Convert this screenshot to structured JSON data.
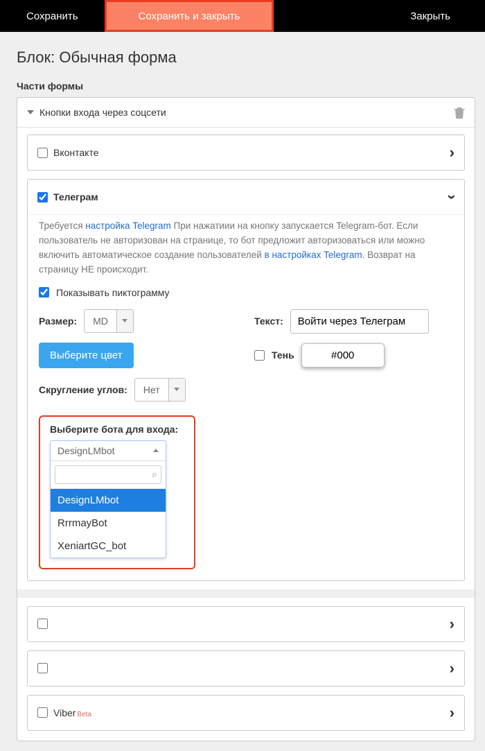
{
  "topbar": {
    "save": "Сохранить",
    "save_close": "Сохранить и закрыть",
    "close": "Закрыть"
  },
  "page": {
    "title": "Блок: Обычная форма",
    "parts_title": "Части формы"
  },
  "accordion": {
    "title": "Кнопки входа через соцсети"
  },
  "vk": {
    "label": "Вконтакте"
  },
  "telegram": {
    "label": "Телеграм",
    "desc_pre": "Требуется ",
    "desc_link1": "настройка Telegram",
    "desc_mid": " При нажатиии на кнопку запускается Telegram-бот. Если пользователь не авторизован на странице, то бот предложит авторизоваться или можно включить автоматическое создание пользователей ",
    "desc_link2": "в настройках Telegram",
    "desc_end": ". Возврат на страницу НЕ происходит.",
    "show_icon_label": "Показывать пиктограмму",
    "size_label": "Размер:",
    "size_value": "MD",
    "color_btn": "Выберите цвет",
    "round_label": "Скругление углов:",
    "round_value": "Нет",
    "text_label": "Текст:",
    "text_value": "Войти через Телеграм",
    "shadow_label": "Тень",
    "shadow_value": "#000",
    "bot_title": "Выберите бота для входа:",
    "bot_selected": "DesignLMbot",
    "bot_search": "",
    "bot_options": [
      "DesignLMbot",
      "RrrmayBot",
      "XeniartGC_bot"
    ]
  },
  "viber": {
    "label": "Viber",
    "beta": "Beta"
  }
}
